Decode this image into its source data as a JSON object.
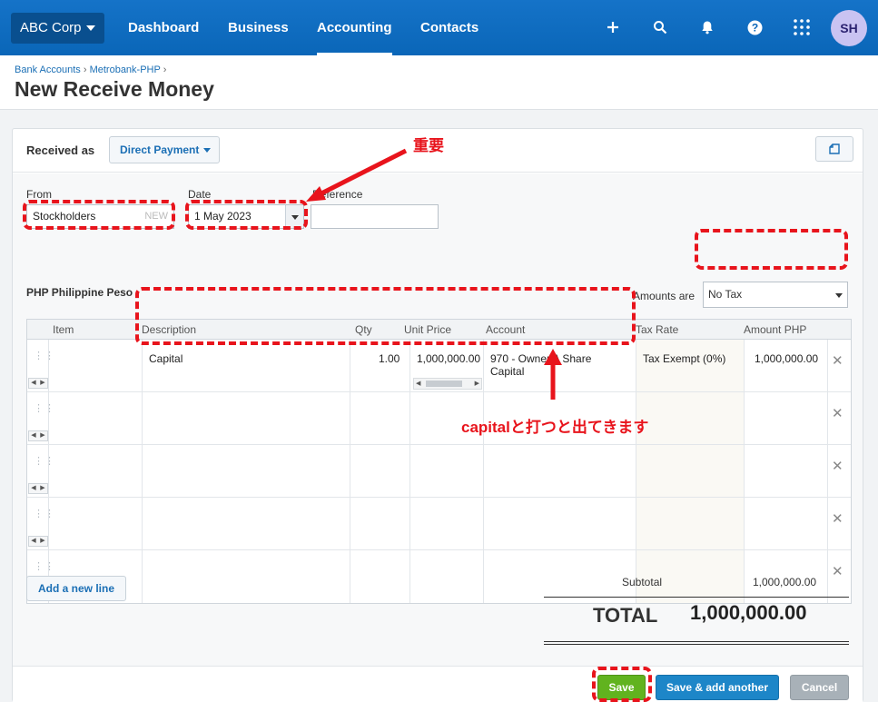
{
  "nav": {
    "org": "ABC Corp",
    "links": [
      "Dashboard",
      "Business",
      "Accounting",
      "Contacts"
    ],
    "active": "Accounting",
    "avatar": "SH",
    "icons": [
      "plus-icon",
      "search-icon",
      "bell-icon",
      "help-icon",
      "apps-grid-icon"
    ]
  },
  "breadcrumb": {
    "items": [
      "Bank Accounts",
      "Metrobank-PHP"
    ],
    "sep": "›"
  },
  "page_title": "New Receive Money",
  "form": {
    "received_as_label": "Received as",
    "received_as_value": "Direct Payment",
    "from_label": "From",
    "from_value": "Stockholders",
    "from_new_tag": "NEW",
    "date_label": "Date",
    "date_value": "1 May 2023",
    "reference_label": "Reference",
    "reference_value": "",
    "currency": "PHP Philippine Peso",
    "amounts_are_label": "Amounts are",
    "amounts_are_value": "No Tax"
  },
  "table": {
    "headers": [
      "Item",
      "Description",
      "Qty",
      "Unit Price",
      "Account",
      "Tax Rate",
      "Amount PHP"
    ],
    "rows": [
      {
        "item": "",
        "description": "Capital",
        "qty": "1.00",
        "unit_price": "1,000,000.00",
        "account_1": "970 - Owner A Share",
        "account_2": "Capital",
        "tax_rate": "Tax Exempt (0%)",
        "amount": "1,000,000.00"
      },
      {
        "item": "",
        "description": "",
        "qty": "",
        "unit_price": "",
        "account_1": "",
        "account_2": "",
        "tax_rate": "",
        "amount": ""
      },
      {
        "item": "",
        "description": "",
        "qty": "",
        "unit_price": "",
        "account_1": "",
        "account_2": "",
        "tax_rate": "",
        "amount": ""
      },
      {
        "item": "",
        "description": "",
        "qty": "",
        "unit_price": "",
        "account_1": "",
        "account_2": "",
        "tax_rate": "",
        "amount": ""
      },
      {
        "item": "",
        "description": "",
        "qty": "",
        "unit_price": "",
        "account_1": "",
        "account_2": "",
        "tax_rate": "",
        "amount": ""
      }
    ],
    "delete_glyph": "✕"
  },
  "add_line_label": "Add a new line",
  "totals": {
    "subtotal_label": "Subtotal",
    "subtotal": "1,000,000.00",
    "total_label": "TOTAL",
    "total": "1,000,000.00"
  },
  "buttons": {
    "save": "Save",
    "save_add": "Save & add another",
    "cancel": "Cancel"
  },
  "annotations": {
    "important": "重要",
    "capital_hint": "capitalと打つと出てきます",
    "color": "#e8141c"
  }
}
